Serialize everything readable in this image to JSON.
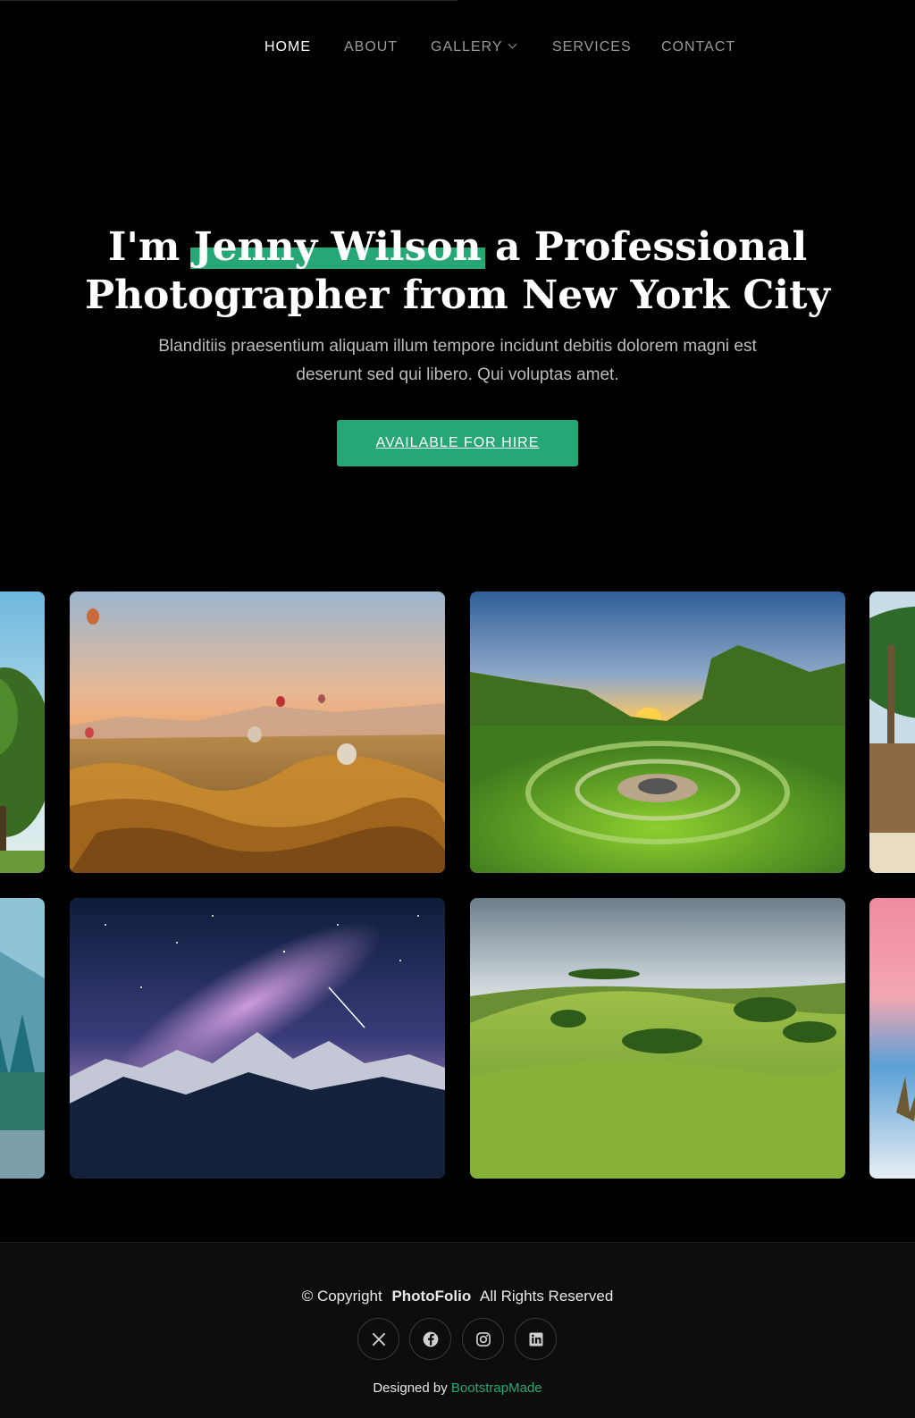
{
  "nav": {
    "items": [
      {
        "label": "HOME",
        "active": true
      },
      {
        "label": "ABOUT"
      },
      {
        "label": "GALLERY"
      },
      {
        "label": "SERVICES"
      },
      {
        "label": "CONTACT"
      }
    ]
  },
  "hero": {
    "title_pre": "I'm",
    "title_name": "Jenny Wilson",
    "title_post": "a Professional",
    "title_line2": "Photographer from New York City",
    "subtitle": "Blanditiis praesentium aliquam illum tempore incidunt debitis dolorem magni est deserunt sed qui libero. Qui voluptas amet.",
    "cta_label": "AVAILABLE FOR HIRE"
  },
  "gallery": {
    "images": [
      {
        "subject": "tree-landscape"
      },
      {
        "subject": "hot-air-balloons-canyon"
      },
      {
        "subject": "green-valley-sunset-stone-circle"
      },
      {
        "subject": "palm-trees-beach"
      },
      {
        "subject": "misty-forest-river"
      },
      {
        "subject": "milky-way-mountains"
      },
      {
        "subject": "green-rolling-hills"
      },
      {
        "subject": "pink-sky-beach"
      }
    ]
  },
  "footer": {
    "copyright_prefix": "© Copyright",
    "brand": "PhotoFolio",
    "rights": "All Rights Reserved",
    "social_icons": [
      "x-twitter-icon",
      "facebook-icon",
      "instagram-icon",
      "linkedin-icon"
    ],
    "credit_prefix": "Designed by",
    "credit_link": "BootstrapMade"
  },
  "colors": {
    "accent": "#27a776",
    "background": "#000000",
    "footer_bg": "#0d0d0d"
  }
}
